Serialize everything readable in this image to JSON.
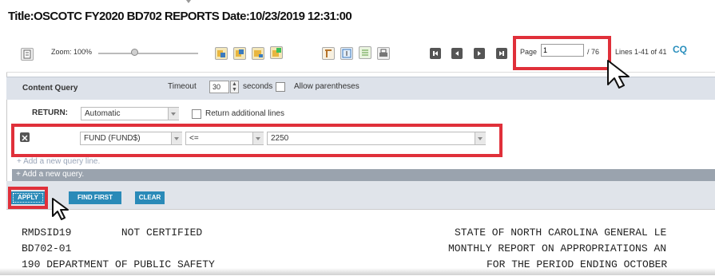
{
  "title": "Title:OSCOTC FY2020 BD702 REPORTS Date:10/23/2019 12:31:00",
  "toolbar": {
    "zoom_label": "Zoom: 100%",
    "zoom_level_percent": 100,
    "page_label": "Page",
    "page_value": "1",
    "page_total": "/ 76",
    "lines_label": "Lines 1-41 of 41",
    "cq_label": "CQ",
    "icons": [
      "document-icon",
      "export-icon",
      "import-icon",
      "save-icon",
      "add-icon",
      "column-icon",
      "text-icon",
      "list-icon",
      "print-icon",
      "first-page-icon",
      "prev-page-icon",
      "next-page-icon",
      "last-page-icon"
    ]
  },
  "content_query": {
    "title": "Content Query",
    "timeout_label": "Timeout",
    "timeout_value": "30",
    "seconds_label": "seconds",
    "allow_parentheses_label": "Allow parentheses",
    "return_label": "RETURN:",
    "return_value": "Automatic",
    "return_additional_label": "Return additional lines",
    "query_line": {
      "field": "FUND (FUND$)",
      "operator": "<=",
      "value": "2250"
    },
    "add_line_label": "+ Add a new query line.",
    "add_query_label": "+ Add a new query.",
    "buttons": {
      "apply": "APPLY",
      "find_first": "FIND FIRST",
      "clear": "CLEAR"
    }
  },
  "report_lines": [
    {
      "left": "RMDSID19        NOT CERTIFIED",
      "right": "STATE OF NORTH CAROLINA GENERAL LE"
    },
    {
      "left": "BD702-01",
      "right": "MONTHLY REPORT ON APPROPRIATIONS AN"
    },
    {
      "left": "190 DEPARTMENT OF PUBLIC SAFETY",
      "right": "FOR THE PERIOD ENDING OCTOBER"
    }
  ],
  "colors": {
    "highlight": "#e0303a",
    "button_blue": "#2a8ab8",
    "cq_blue": "#2a8fbd",
    "panel_gray": "#dde2ea"
  }
}
